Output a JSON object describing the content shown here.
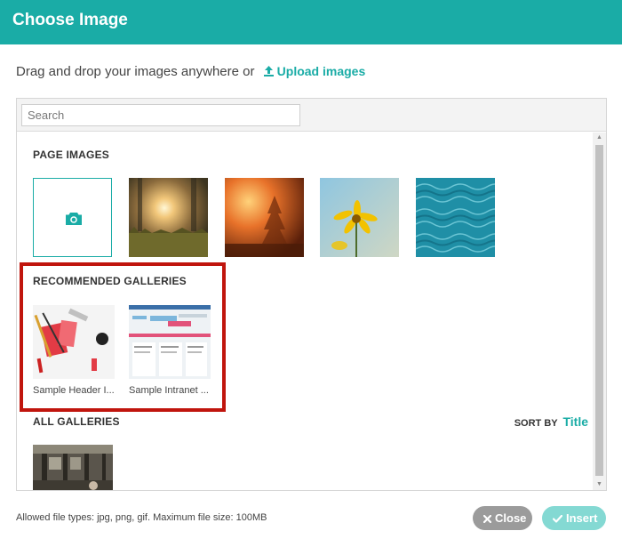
{
  "dialog": {
    "title": "Choose Image"
  },
  "drop_zone": {
    "text": "Drag and drop your images anywhere or",
    "upload_label": "Upload images"
  },
  "search": {
    "placeholder": "Search",
    "value": ""
  },
  "page_images": {
    "title": "PAGE IMAGES",
    "items": [
      {
        "icon": "camera-icon"
      },
      {
        "description": "sunset-forest"
      },
      {
        "description": "orange-misty-forest"
      },
      {
        "description": "yellow-flower"
      },
      {
        "description": "blue-water"
      }
    ]
  },
  "recommended": {
    "title": "RECOMMENDED GALLERIES",
    "items": [
      {
        "name": "Sample Header I..."
      },
      {
        "name": "Sample Intranet ..."
      }
    ]
  },
  "all_galleries": {
    "title": "ALL GALLERIES",
    "sort_label": "SORT BY",
    "sort_value": "Title"
  },
  "footer": {
    "info": "Allowed file types: jpg, png, gif. Maximum file size: 100MB",
    "close_label": "Close",
    "insert_label": "Insert"
  },
  "colors": {
    "accent": "#1aaca6",
    "highlight": "#c0150d",
    "close_btn": "#9b9b9b",
    "insert_btn": "#84d9d3"
  }
}
